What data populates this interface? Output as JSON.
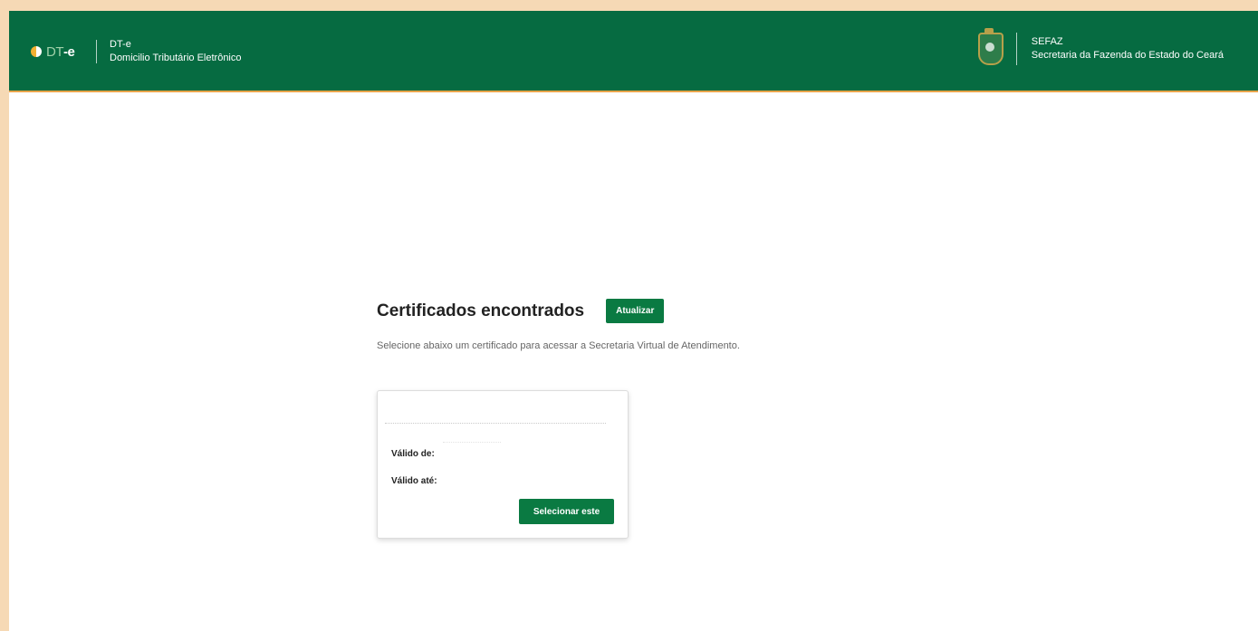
{
  "header": {
    "brand": {
      "logo_prefix": "DT",
      "logo_suffix": "-e",
      "name": "DT-e",
      "subtitle": "Domicilio Tributário Eletrônico"
    },
    "agency": {
      "name": "SEFAZ",
      "subtitle": "Secretaria da Fazenda do Estado do Ceará",
      "crest_icon": "state-coat-of-arms-icon"
    },
    "colors": {
      "header_bg": "#066b41",
      "accent": "#e8a44a"
    }
  },
  "main": {
    "title": "Certificados encontrados",
    "refresh_label": "Atualizar",
    "instruction": "Selecione abaixo um certificado para acessar a Secretaria Virtual de Atendimento."
  },
  "certificate": {
    "valid_from_label": "Válido de:",
    "valid_to_label": "Válido até:",
    "select_label": "Selecionar este"
  },
  "colors": {
    "primary_button": "#0a7a42",
    "outer_background": "#f6d9b5"
  }
}
